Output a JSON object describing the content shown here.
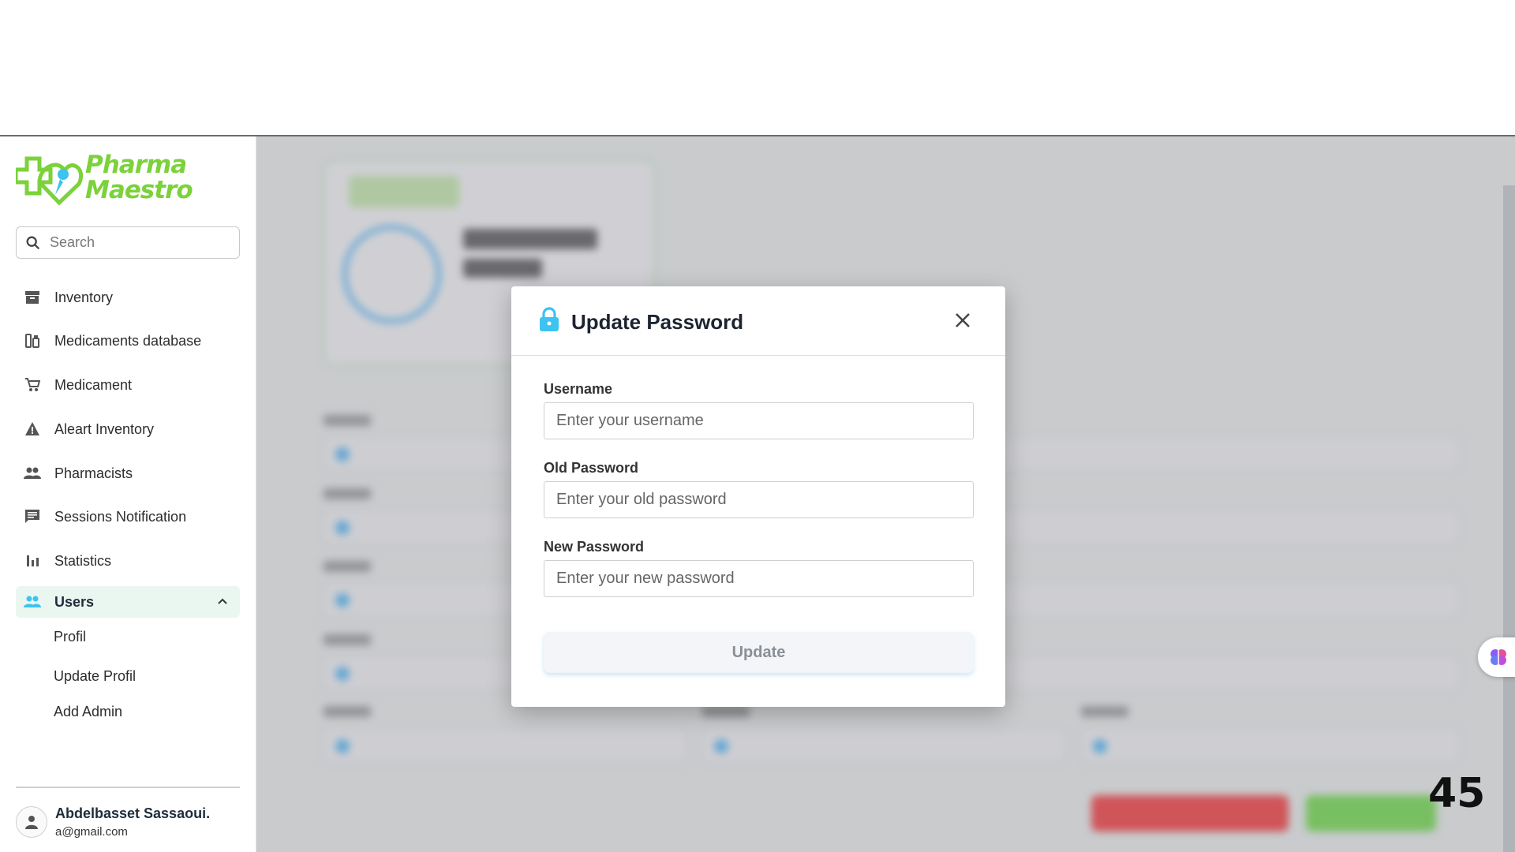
{
  "app": {
    "logo_line1": "Pharma",
    "logo_line2": "Maestro"
  },
  "sidebar": {
    "search_placeholder": "Search",
    "items": [
      {
        "label": "Inventory",
        "icon": "archive-icon"
      },
      {
        "label": "Medicaments database",
        "icon": "medicine-icon"
      },
      {
        "label": "Medicament",
        "icon": "cart-icon"
      },
      {
        "label": "Aleart Inventory",
        "icon": "warning-icon"
      },
      {
        "label": "Pharmacists",
        "icon": "people-icon"
      },
      {
        "label": "Sessions Notification",
        "icon": "chat-icon"
      },
      {
        "label": "Statistics",
        "icon": "bar-chart-icon"
      },
      {
        "label": "Users",
        "icon": "people-icon",
        "active": true,
        "expanded": true
      }
    ],
    "sub_items": [
      {
        "label": "Profil"
      },
      {
        "label": "Update Profil"
      },
      {
        "label": "Add Admin"
      }
    ],
    "user": {
      "name": "Abdelbasset Sassaoui.",
      "email": "a@gmail.com"
    }
  },
  "modal": {
    "title": "Update Password",
    "fields": [
      {
        "label": "Username",
        "placeholder": "Enter your username"
      },
      {
        "label": "Old Password",
        "placeholder": "Enter your old password"
      },
      {
        "label": "New Password",
        "placeholder": "Enter your new password"
      }
    ],
    "submit_label": "Update"
  },
  "overlay_number": "45",
  "colors": {
    "brand_green": "#7bd23a",
    "brand_blue": "#3cc3f0",
    "active_bg": "#eaf6f0"
  }
}
